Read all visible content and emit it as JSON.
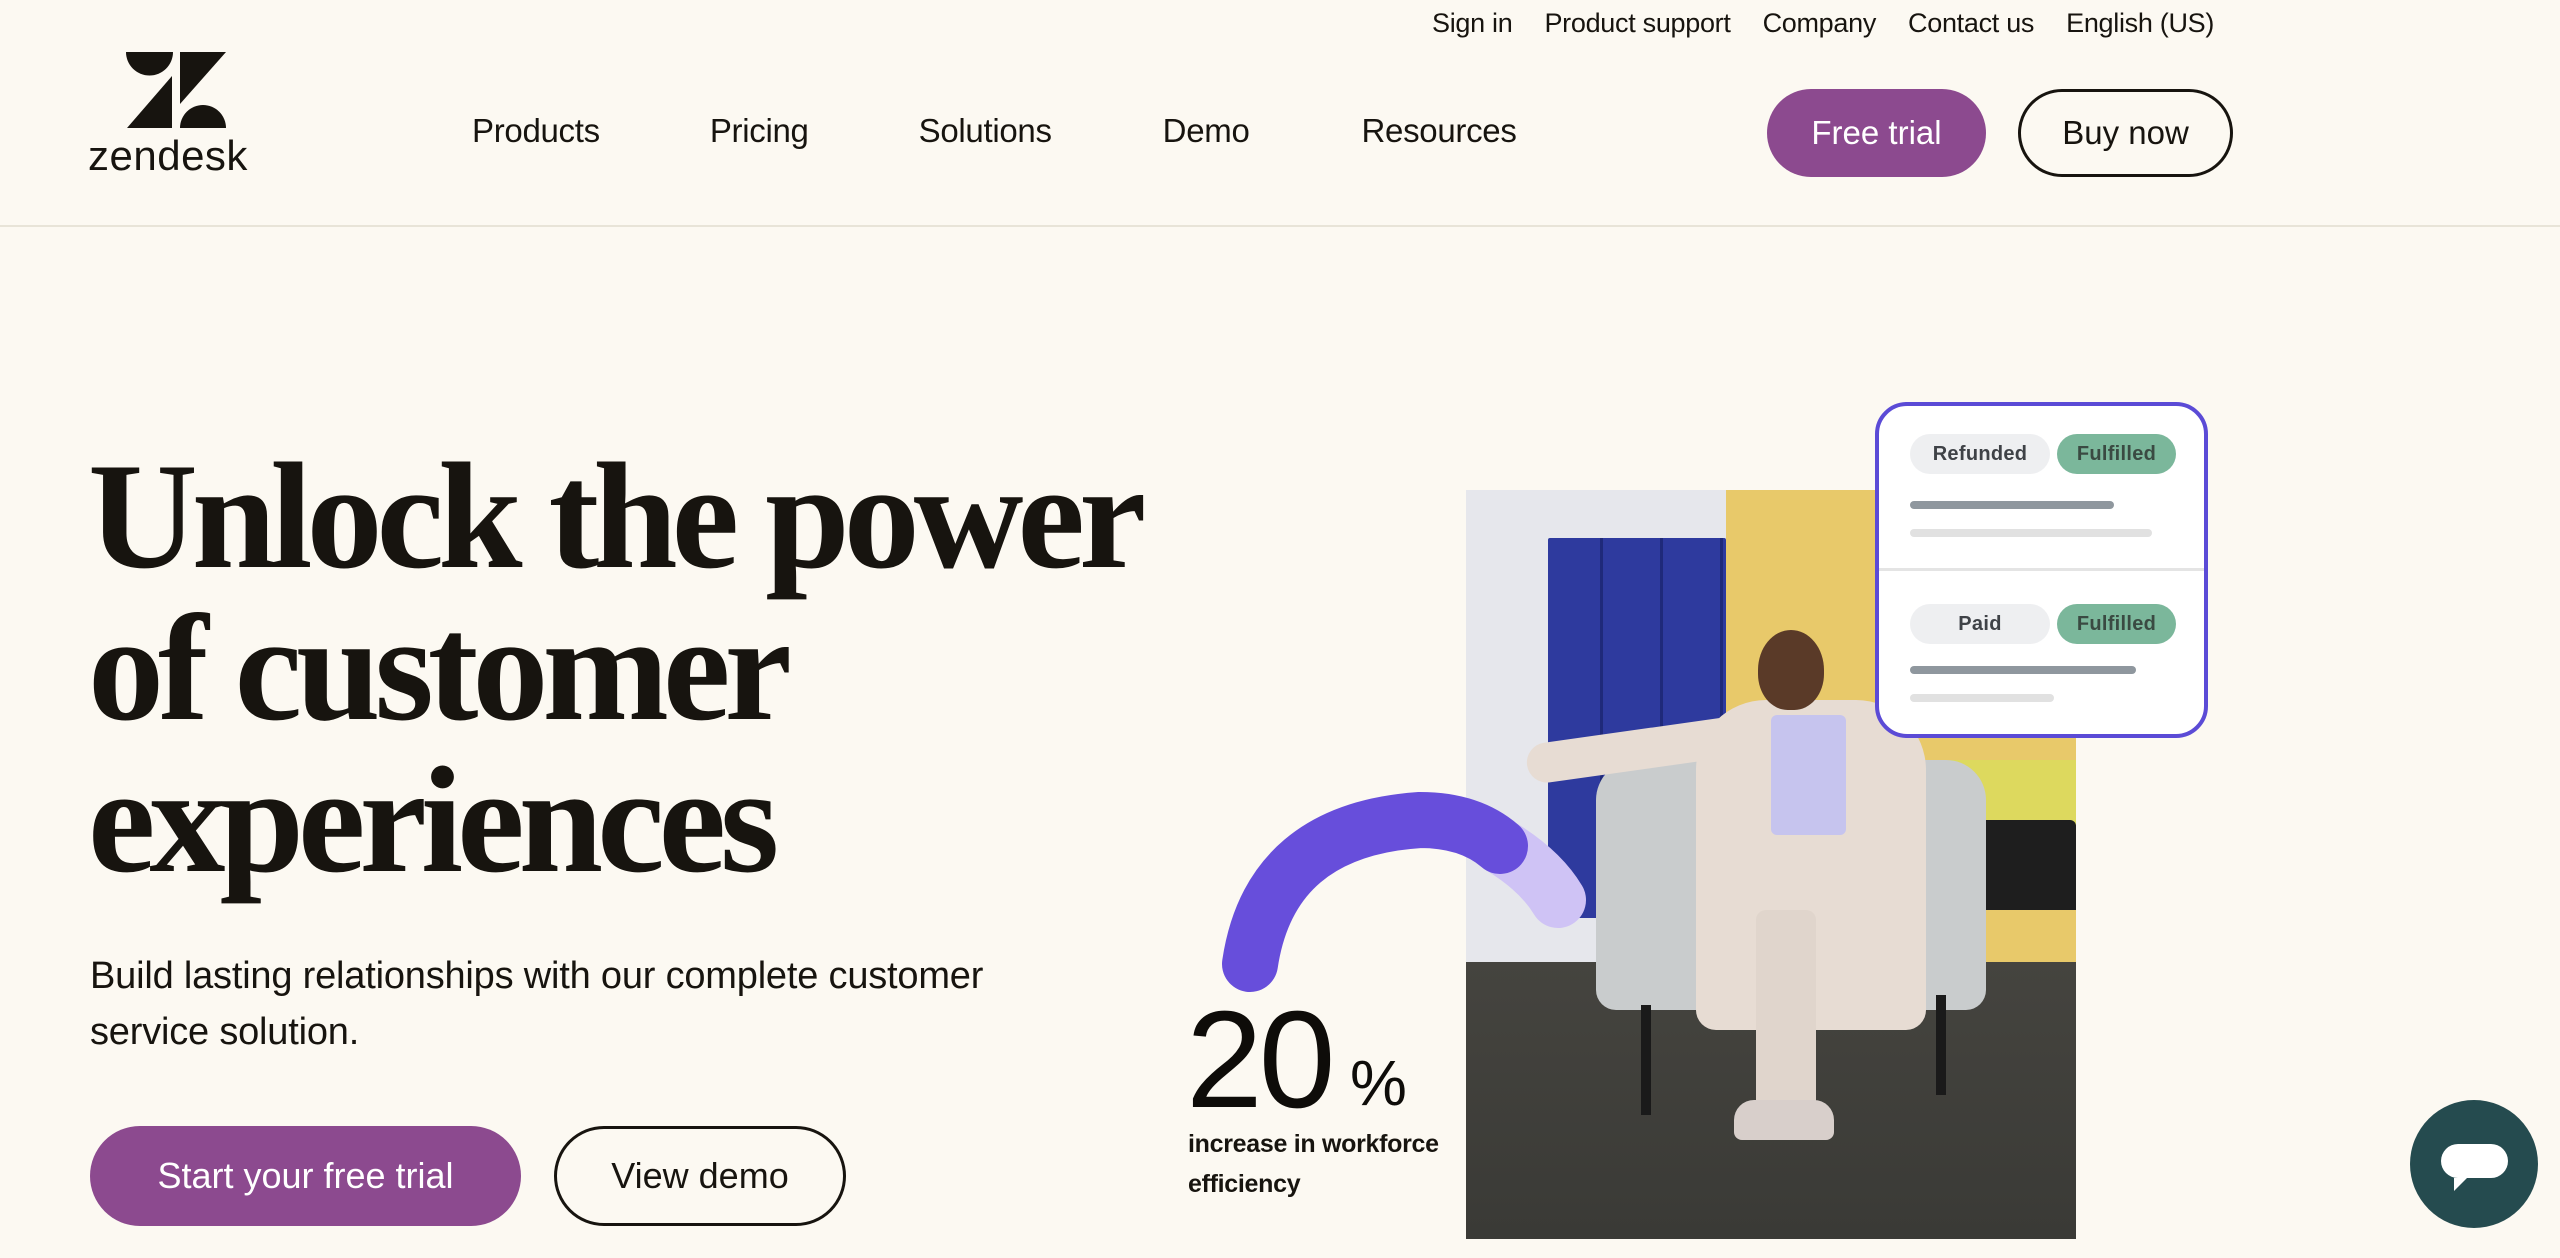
{
  "brand": {
    "name": "zendesk",
    "logo_icon": "zendesk-z-logo"
  },
  "utility_nav": [
    {
      "label": "Sign in"
    },
    {
      "label": "Product support"
    },
    {
      "label": "Company"
    },
    {
      "label": "Contact us"
    },
    {
      "label": "English (US)"
    }
  ],
  "main_nav": [
    {
      "label": "Products"
    },
    {
      "label": "Pricing"
    },
    {
      "label": "Solutions"
    },
    {
      "label": "Demo"
    },
    {
      "label": "Resources"
    }
  ],
  "header_buttons": {
    "free_trial": "Free trial",
    "buy_now": "Buy now"
  },
  "hero": {
    "headline": "Unlock the power of customer experiences",
    "subtitle": "Build lasting relationships with our complete customer service solution.",
    "cta_primary": "Start your free trial",
    "cta_secondary": "View demo"
  },
  "stat": {
    "value": "20",
    "unit": "%",
    "label": "increase in workforce efficiency",
    "gauge_fraction": 0.2
  },
  "order_card": {
    "rows": [
      {
        "status": "Refunded",
        "fulfillment": "Fulfilled"
      },
      {
        "status": "Paid",
        "fulfillment": "Fulfilled"
      }
    ]
  },
  "chat_widget": {
    "icon": "chat-bubble-icon"
  },
  "colors": {
    "background": "#FCF9F2",
    "brand_purple": "#8C4A8F",
    "text": "#17140F",
    "gauge_dark": "#674EDB",
    "gauge_light": "#CFC3F5",
    "card_border": "#5B4BD6",
    "pill_green": "#7BB79B",
    "chat": "#254B4F"
  }
}
